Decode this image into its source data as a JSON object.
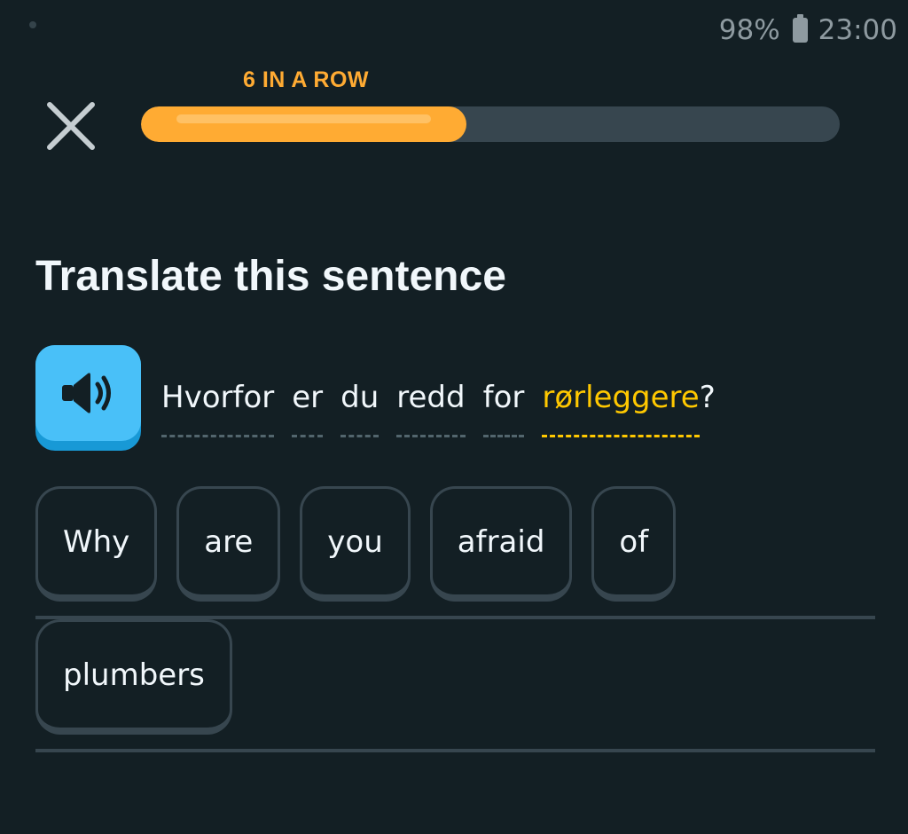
{
  "status_bar": {
    "battery_text": "98%",
    "time": "23:00"
  },
  "header": {
    "streak_label": "6 IN A ROW",
    "progress": 0.4657,
    "progress_color": "#ffab33",
    "close_icon": "close-icon"
  },
  "challenge": {
    "title": "Translate this sentence",
    "speaker_icon": "speaker-icon",
    "sentence_words": [
      "Hvorfor",
      "er",
      "du",
      "redd",
      "for",
      "rørleggere"
    ],
    "sentence_punctuation": "?",
    "highlight_color": "#ffc800"
  },
  "answer": {
    "line_1": [
      "Why",
      "are",
      "you",
      "afraid",
      "of"
    ],
    "line_2": [
      "plumbers"
    ]
  }
}
